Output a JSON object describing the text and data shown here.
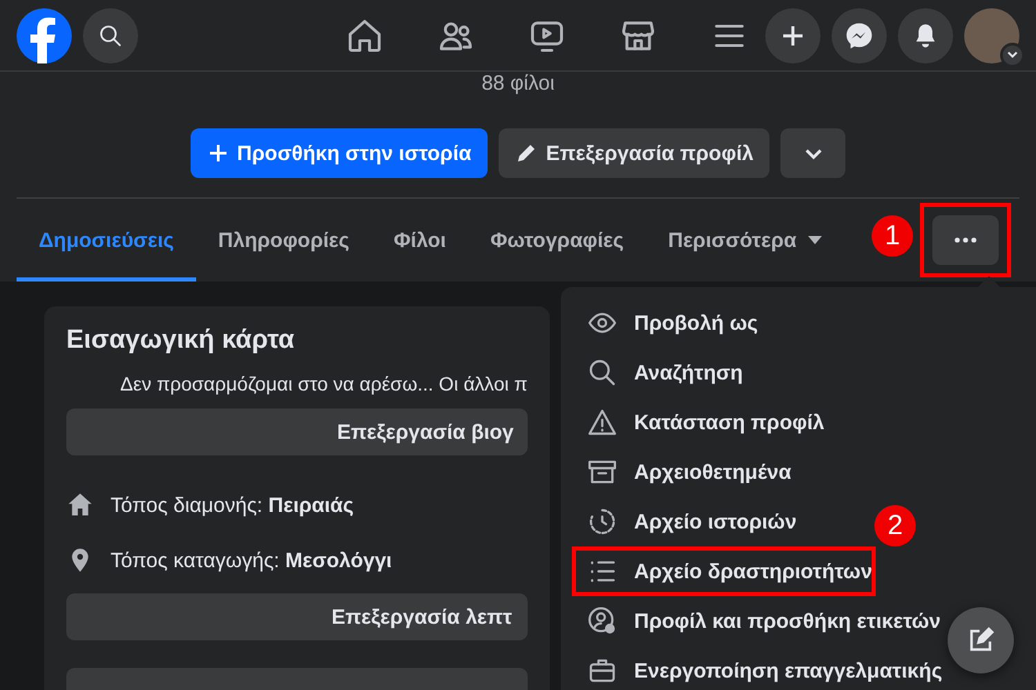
{
  "header": {
    "friends_count": "88 φίλοι",
    "actions": [
      {
        "kind": "primary",
        "label": "Προσθήκη στην ιστορία"
      },
      {
        "kind": "secondary",
        "label": "Επεξεργασία προφίλ"
      },
      {
        "kind": "dropdown"
      }
    ]
  },
  "tabs": [
    {
      "label": "Δημοσιεύσεις",
      "selected": true,
      "dropdown": false
    },
    {
      "label": "Πληροφορίες",
      "selected": false,
      "dropdown": false
    },
    {
      "label": "Φίλοι",
      "selected": false,
      "dropdown": false
    },
    {
      "label": "Φωτογραφίες",
      "selected": false,
      "dropdown": false
    },
    {
      "label": "Περισσότερα",
      "selected": false,
      "dropdown": true
    }
  ],
  "more_button": {
    "annotated": true,
    "callout": "1"
  },
  "intro_card": {
    "title": "Εισαγωγική κάρτα",
    "bio": "Δεν προσαρμόζομαι στο να αρέσω... Οι άλλοι π",
    "edit_bio_button": "Επεξεργασία βιογ",
    "details": [
      {
        "kind": "home",
        "label": "Τόπος διαμονής:",
        "value": "Πειραιάς"
      },
      {
        "kind": "pin",
        "label": "Τόπος καταγωγής:",
        "value": "Μεσολόγγι"
      }
    ],
    "edit_details_button": "Επεξεργασία λεπτ"
  },
  "menu": {
    "items": [
      {
        "kind": "eye",
        "label": "Προβολή ως",
        "annotated": false
      },
      {
        "kind": "search",
        "label": "Αναζήτηση",
        "annotated": false
      },
      {
        "kind": "warning",
        "label": "Κατάσταση προφίλ",
        "annotated": false
      },
      {
        "kind": "archive",
        "label": "Αρχειοθετημένα",
        "annotated": false
      },
      {
        "kind": "clock",
        "label": "Αρχείο ιστοριών",
        "annotated": false
      },
      {
        "kind": "list",
        "label": "Αρχείο δραστηριοτήτων",
        "annotated": true,
        "callout": "2"
      },
      {
        "kind": "user-gear",
        "label": "Προφίλ και προσθήκη ετικετών",
        "annotated": false
      },
      {
        "kind": "briefcase",
        "label": "Ενεργοποίηση επαγγελματικής",
        "annotated": false
      }
    ]
  }
}
